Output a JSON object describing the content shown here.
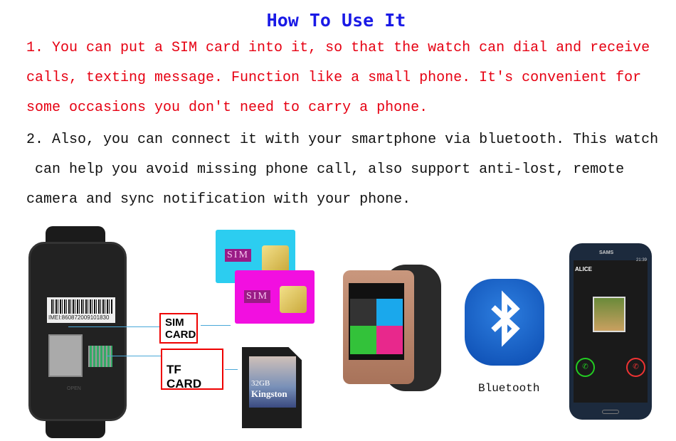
{
  "title": "How To Use It",
  "step1": {
    "lines": [
      "1. You can put a SIM card into it, so that the watch can dial and receive",
      "calls, texting message. Function like a small phone. It's convenient for",
      "some occasions you don't need to carry a phone."
    ]
  },
  "step2": {
    "lines": [
      "2. Also, you can connect it with your smartphone via bluetooth. This watch",
      " can help you avoid missing phone call, also support anti-lost, remote",
      "camera and sync notification with your phone."
    ]
  },
  "labels": {
    "sim_card_line1": "SIM",
    "sim_card_line2": "CARD",
    "tf_card": "TF CARD",
    "bluetooth": "Bluetooth"
  },
  "watch_back": {
    "imei": "IMEI:860872009101830",
    "open": "OPEN"
  },
  "sim_cards": {
    "label": "SIM"
  },
  "sd_card": {
    "capacity": "32GB",
    "brand": "Kingston"
  },
  "phone": {
    "brand": "SAMS",
    "caller": "ALICE",
    "time": "21:39"
  },
  "colors": {
    "title": "#1a1ae6",
    "step1": "#e60012",
    "step2": "#111111",
    "callout_border": "#ee0000",
    "sim_blue": "#2ccdf0",
    "sim_pink": "#f20fe0",
    "bluetooth": "#1565d0"
  },
  "icons": [
    "bluetooth-icon",
    "answer-call-icon",
    "decline-call-icon"
  ]
}
